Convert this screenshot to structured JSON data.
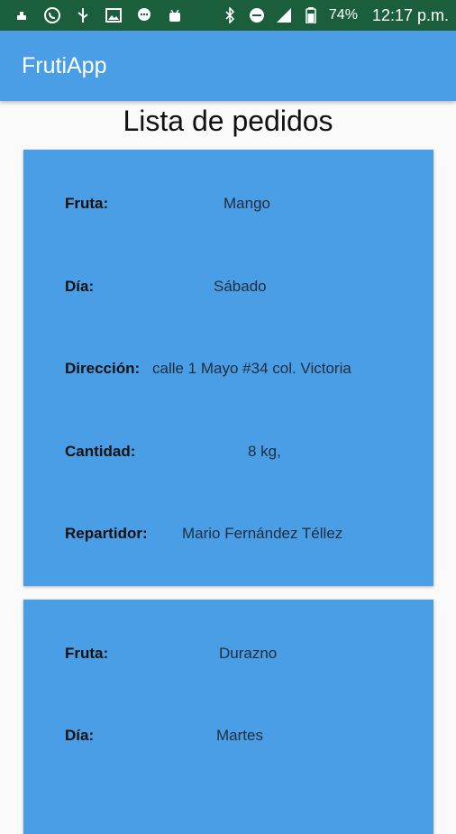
{
  "status_bar": {
    "battery": "74%",
    "time": "12:17 p.m.",
    "left_icons": [
      "notification-icon",
      "whatsapp-icon",
      "usb-icon",
      "image-icon",
      "chat-icon",
      "android-icon"
    ],
    "right_icons": [
      "bluetooth-icon",
      "do-not-disturb-icon",
      "signal-icon",
      "battery-icon"
    ]
  },
  "app_bar": {
    "title": "FrutiApp"
  },
  "page": {
    "title": "Lista de pedidos"
  },
  "orders": [
    {
      "fruta_label": "Fruta:",
      "fruta": "Mango",
      "dia_label": "Día:",
      "dia": "Sábado",
      "direccion_label": "Dirección:",
      "direccion": "calle 1 Mayo #34 col. Victoria",
      "cantidad_label": "Cantidad:",
      "cantidad": "8 kg,",
      "repartidor_label": "Repartidor:",
      "repartidor": "Mario Fernández Téllez"
    },
    {
      "fruta_label": "Fruta:",
      "fruta": "Durazno",
      "dia_label": "Día:",
      "dia": "Martes"
    }
  ],
  "colors": {
    "status_bar": "#1b5e3c",
    "app_bar": "#4a9ee6",
    "card": "#4a9ee6",
    "background": "#fafafa"
  }
}
